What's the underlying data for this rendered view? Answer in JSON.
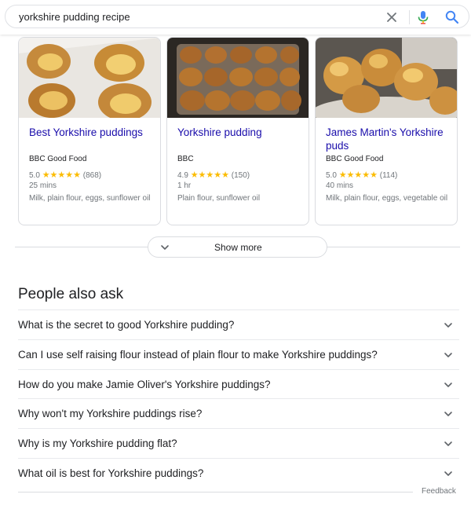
{
  "search": {
    "query": "yorkshire pudding recipe"
  },
  "icons": {
    "clear": "close-icon",
    "mic": "microphone-icon",
    "search": "search-icon",
    "chevron": "chevron-down-icon"
  },
  "colors": {
    "link": "#1a0dab",
    "star": "#fbbc04",
    "mic_blue": "#4285f4",
    "mic_red": "#ea4335",
    "text_secondary": "#70757a"
  },
  "recipes": [
    {
      "title": "Best Yorkshire puddings",
      "source": "BBC Good Food",
      "rating": "5.0",
      "stars": "★★★★★",
      "reviews": "(868)",
      "time": "25 mins",
      "ingredients": "Milk, plain flour, eggs, sunflower oil"
    },
    {
      "title": "Yorkshire pudding",
      "source": "BBC",
      "rating": "4.9",
      "stars": "★★★★★",
      "reviews": "(150)",
      "time": "1 hr",
      "ingredients": "Plain flour, sunflower oil"
    },
    {
      "title": "James Martin's Yorkshire puds",
      "source": "BBC Good Food",
      "rating": "5.0",
      "stars": "★★★★★",
      "reviews": "(114)",
      "time": "40 mins",
      "ingredients": "Milk, plain flour, eggs, vegetable oil"
    }
  ],
  "show_more": {
    "label": "Show more"
  },
  "people_also_ask": {
    "title": "People also ask",
    "questions": [
      "What is the secret to good Yorkshire pudding?",
      "Can I use self raising flour instead of plain flour to make Yorkshire puddings?",
      "How do you make Jamie Oliver's Yorkshire puddings?",
      "Why won't my Yorkshire puddings rise?",
      "Why is my Yorkshire pudding flat?",
      "What oil is best for Yorkshire puddings?"
    ]
  },
  "feedback": {
    "label": "Feedback"
  }
}
